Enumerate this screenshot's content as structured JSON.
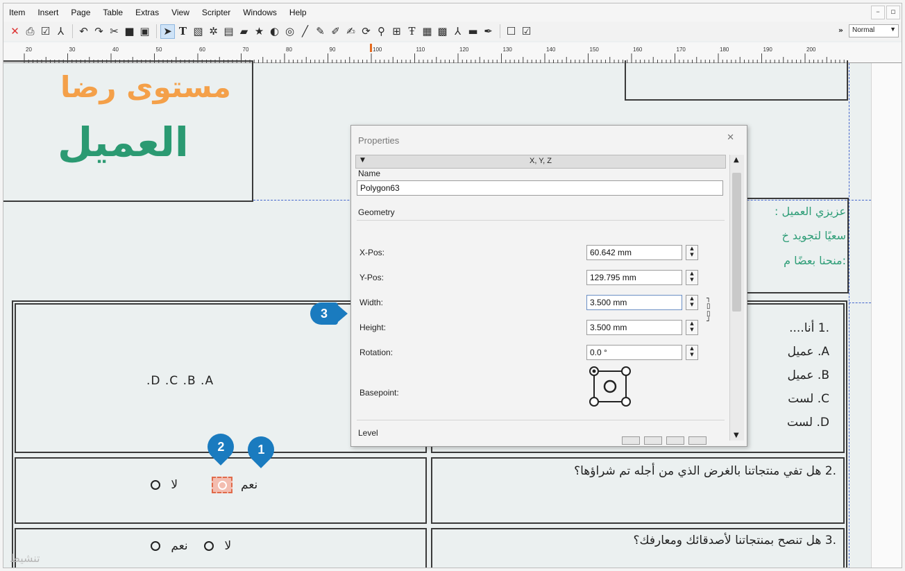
{
  "menu": [
    "Item",
    "Insert",
    "Page",
    "Table",
    "Extras",
    "View",
    "Scripter",
    "Windows",
    "Help"
  ],
  "toolbar": {
    "more": "»",
    "mode": "Normal"
  },
  "ruler": {
    "labels": [
      "20",
      "30",
      "40",
      "50",
      "60",
      "70",
      "80",
      "90",
      "100",
      "110",
      "120",
      "130",
      "140",
      "150",
      "160",
      "170",
      "180",
      "190",
      "200"
    ]
  },
  "document": {
    "title_line1": "مستوى رضا",
    "title_line2": "العميل",
    "greeting_lines": [
      "عزيزي العميل :",
      "سعيًا لتجويد خ",
      ":منحنا بعضًا م"
    ],
    "q1": {
      "text": ".1 أنا....",
      "options": [
        "A. عميل",
        "B. عميل",
        "C. لست",
        "D. لست"
      ],
      "answer_letters": ".D   .C   .B   .A"
    },
    "q2": {
      "text": ".2 هل تفي منتجاتنا بالغرض الذي من أجله تم شراؤها؟",
      "yes": "نعم",
      "no": "لا"
    },
    "q3": {
      "text": ".3 هل تنصح بمنتجاتنا لأصدقائك ومعارفك؟",
      "yes": "نعم",
      "no": "لا"
    }
  },
  "markers": {
    "m1": "1",
    "m2": "2",
    "m3": "3"
  },
  "properties": {
    "title": "Properties",
    "section": "X, Y, Z",
    "name_label": "Name",
    "name_value": "Polygon63",
    "geometry_label": "Geometry",
    "xpos_label": "X-Pos:",
    "xpos_value": "60.642 mm",
    "ypos_label": "Y-Pos:",
    "ypos_value": "129.795 mm",
    "width_label": "Width:",
    "width_value": "3.500 mm",
    "height_label": "Height:",
    "height_value": "3.500 mm",
    "rotation_label": "Rotation:",
    "rotation_value": "0.0 °",
    "basepoint_label": "Basepoint:",
    "level_label": "Level"
  },
  "watermark": "تنشيط"
}
